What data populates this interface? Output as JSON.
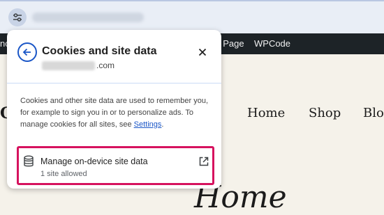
{
  "admin_bar": {
    "left_fragment": "nc",
    "items": [
      "t Page",
      "WPCode"
    ]
  },
  "site": {
    "logo_fragment": "C",
    "nav": [
      "Home",
      "Shop",
      "Blog"
    ],
    "hero_title": "Home"
  },
  "popup": {
    "title": "Cookies and site data",
    "domain_suffix": ".com",
    "description_prefix": "Cookies and other site data are used to remember you, for example to sign you in or to personalize ads. To manage cookies for all sites, see ",
    "settings_link": "Settings",
    "description_suffix": ".",
    "manage": {
      "title": "Manage on-device site data",
      "subtitle": "1 site allowed"
    }
  },
  "icons": {
    "site_info": "tune-icon",
    "back": "arrow-left-icon",
    "close": "close-icon",
    "database": "database-icon",
    "open_external": "open-in-new-icon"
  },
  "colors": {
    "accent": "#1a56c7",
    "highlight": "#d6125e",
    "admin_bar": "#1d2327"
  }
}
